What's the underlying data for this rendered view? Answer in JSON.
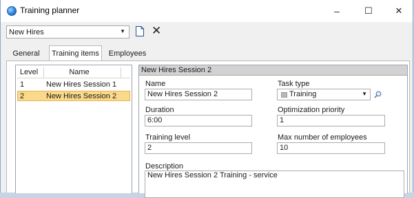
{
  "window": {
    "title": "Training planner",
    "minimize": "–",
    "maximize": "☐",
    "close": "✕"
  },
  "toolbar": {
    "plan_selected": "New Hires",
    "new_icon": "new-document-icon",
    "delete_icon": "close-icon",
    "delete_glyph": "✕"
  },
  "tabs": [
    {
      "label": "General"
    },
    {
      "label": "Training items"
    },
    {
      "label": "Employees"
    }
  ],
  "list": {
    "columns": [
      "Level",
      "Name"
    ],
    "rows": [
      {
        "level": "1",
        "name": "New Hires Session 1"
      },
      {
        "level": "2",
        "name": "New Hires Session 2"
      }
    ]
  },
  "detail": {
    "header": "New Hires Session 2",
    "name_label": "Name",
    "name_value": "New Hires Session 2",
    "task_type_label": "Task type",
    "task_type_value": "Training",
    "duration_label": "Duration",
    "duration_value": "6:00",
    "opt_priority_label": "Optimization priority",
    "opt_priority_value": "1",
    "training_level_label": "Training level",
    "training_level_value": "2",
    "max_emp_label": "Max number of employees",
    "max_emp_value": "10",
    "description_label": "Description",
    "description_value": "New Hires Session 2 Training - service"
  },
  "colors": {
    "selection": "#fbd98a",
    "selection_border": "#e2b54c",
    "accent": "#2a7bd6"
  }
}
